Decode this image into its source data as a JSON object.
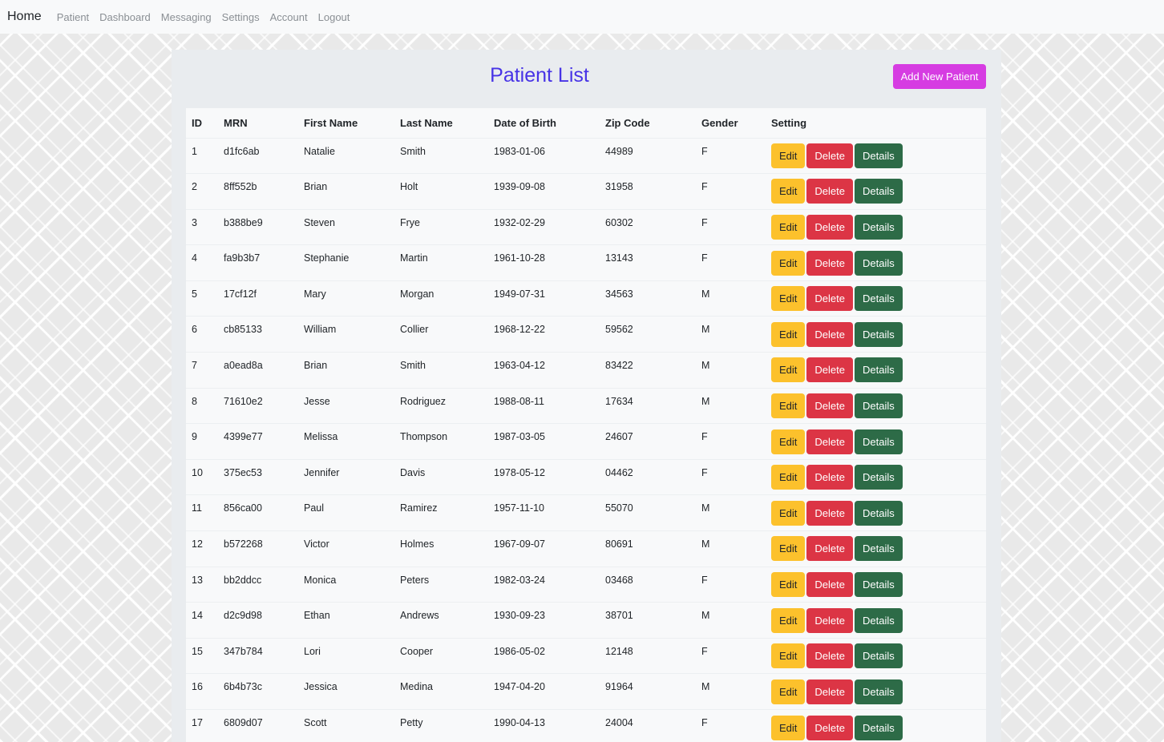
{
  "nav": {
    "brand": "Home",
    "links": [
      "Patient",
      "Dashboard",
      "Messaging",
      "Settings",
      "Account",
      "Logout"
    ]
  },
  "page": {
    "title": "Patient List",
    "add_button": "Add New Patient"
  },
  "table": {
    "headers": [
      "ID",
      "MRN",
      "First Name",
      "Last Name",
      "Date of Birth",
      "Zip Code",
      "Gender",
      "Setting"
    ],
    "buttons": {
      "edit": "Edit",
      "delete": "Delete",
      "details": "Details"
    },
    "rows": [
      [
        "1",
        "d1fc6ab",
        "Natalie",
        "Smith",
        "1983-01-06",
        "44989",
        "F"
      ],
      [
        "2",
        "8ff552b",
        "Brian",
        "Holt",
        "1939-09-08",
        "31958",
        "F"
      ],
      [
        "3",
        "b388be9",
        "Steven",
        "Frye",
        "1932-02-29",
        "60302",
        "F"
      ],
      [
        "4",
        "fa9b3b7",
        "Stephanie",
        "Martin",
        "1961-10-28",
        "13143",
        "F"
      ],
      [
        "5",
        "17cf12f",
        "Mary",
        "Morgan",
        "1949-07-31",
        "34563",
        "M"
      ],
      [
        "6",
        "cb85133",
        "William",
        "Collier",
        "1968-12-22",
        "59562",
        "M"
      ],
      [
        "7",
        "a0ead8a",
        "Brian",
        "Smith",
        "1963-04-12",
        "83422",
        "M"
      ],
      [
        "8",
        "71610e2",
        "Jesse",
        "Rodriguez",
        "1988-08-11",
        "17634",
        "M"
      ],
      [
        "9",
        "4399e77",
        "Melissa",
        "Thompson",
        "1987-03-05",
        "24607",
        "F"
      ],
      [
        "10",
        "375ec53",
        "Jennifer",
        "Davis",
        "1978-05-12",
        "04462",
        "F"
      ],
      [
        "11",
        "856ca00",
        "Paul",
        "Ramirez",
        "1957-11-10",
        "55070",
        "M"
      ],
      [
        "12",
        "b572268",
        "Victor",
        "Holmes",
        "1967-09-07",
        "80691",
        "M"
      ],
      [
        "13",
        "bb2ddcc",
        "Monica",
        "Peters",
        "1982-03-24",
        "03468",
        "F"
      ],
      [
        "14",
        "d2c9d98",
        "Ethan",
        "Andrews",
        "1930-09-23",
        "38701",
        "M"
      ],
      [
        "15",
        "347b784",
        "Lori",
        "Cooper",
        "1986-05-02",
        "12148",
        "F"
      ],
      [
        "16",
        "6b4b73c",
        "Jessica",
        "Medina",
        "1947-04-20",
        "91964",
        "M"
      ],
      [
        "17",
        "6809d07",
        "Scott",
        "Petty",
        "1990-04-13",
        "24004",
        "F"
      ]
    ]
  }
}
